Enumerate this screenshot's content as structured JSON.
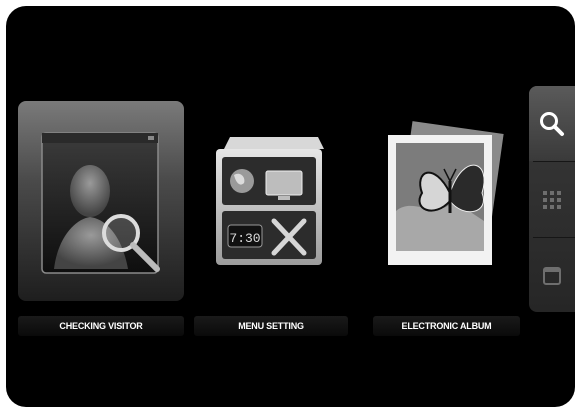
{
  "menu": {
    "tiles": [
      {
        "label": "CHECKING VISITOR",
        "icon": "visitor-search-icon",
        "selected": true
      },
      {
        "label": "MENU SETTING",
        "icon": "settings-cabinet-icon",
        "selected": false
      },
      {
        "label": "ELECTRONIC ALBUM",
        "icon": "photo-album-icon",
        "selected": false
      }
    ],
    "clock_display": "7:30"
  },
  "sidebar": {
    "buttons": [
      {
        "icon": "search-icon",
        "selected": true
      },
      {
        "icon": "grid-icon",
        "selected": false
      },
      {
        "icon": "window-icon",
        "selected": false
      }
    ]
  },
  "colors": {
    "background": "#000000",
    "tile_selected_top": "#7a7a7a",
    "label_text": "#ffffff"
  }
}
